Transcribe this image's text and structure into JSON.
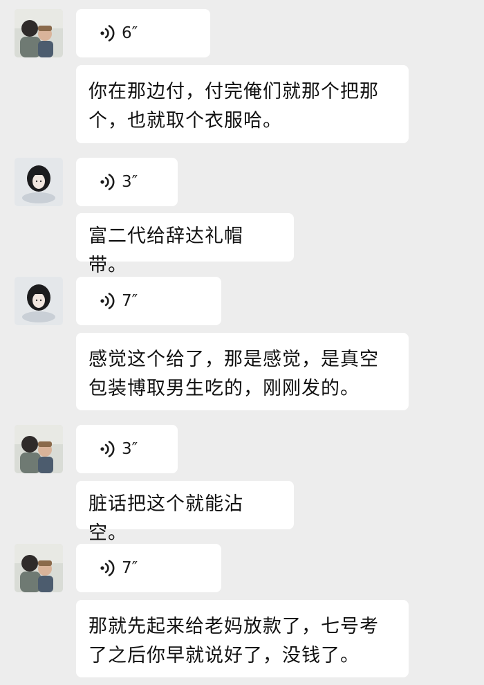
{
  "messages": [
    {
      "sender": "person-holding-child",
      "voice_duration": "6″",
      "transcript": "你在那边付，付完俺们就那个把那个，也就取个衣服哈。"
    },
    {
      "sender": "girl-illustration",
      "voice_duration": "3″",
      "transcript": "富二代给辞达礼帽带。"
    },
    {
      "sender": "girl-illustration",
      "voice_duration": "7″",
      "transcript": "感觉这个给了，那是感觉，是真空包装博取男生吃的，刚刚发的。"
    },
    {
      "sender": "person-holding-child",
      "voice_duration": "3″",
      "transcript": "脏话把这个就能沾空。"
    },
    {
      "sender": "person-holding-child",
      "voice_duration": "7″",
      "transcript": "那就先起来给老妈放款了，七号考了之后你早就说好了，没钱了。"
    }
  ],
  "icons": {
    "voice": "voice-wave-icon"
  },
  "colors": {
    "background": "#ededed",
    "bubble": "#ffffff",
    "text": "#111111"
  }
}
